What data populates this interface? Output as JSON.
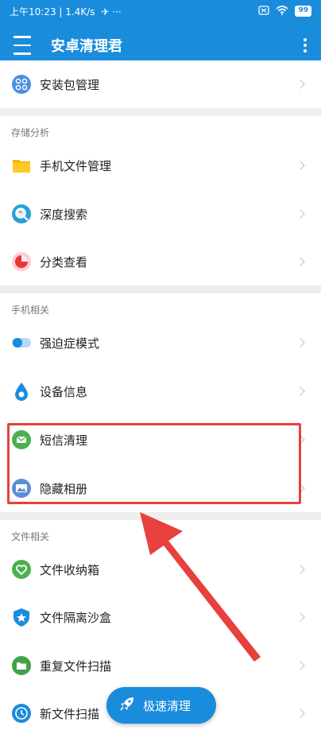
{
  "status_bar": {
    "time": "上午10:23",
    "speed": "1.4K/s",
    "battery": "99"
  },
  "app_bar": {
    "title": "安卓清理君",
    "menu_icon": "hamburger-menu-icon",
    "more_icon": "more-vertical-icon"
  },
  "rows": {
    "apk": {
      "label": "安装包管理",
      "icon": "apps-grid-icon",
      "color": "#4a90e2"
    },
    "file_manager": {
      "label": "手机文件管理",
      "icon": "folder-icon",
      "color": "#f5b800"
    },
    "deep_search": {
      "label": "深度搜索",
      "icon": "search-globe-icon",
      "color": "#2a9fd6"
    },
    "category": {
      "label": "分类查看",
      "icon": "pie-chart-icon",
      "color": "#e53935"
    },
    "ocd_mode": {
      "label": "强迫症模式",
      "icon": "toggle-icon",
      "color": "#1a8cdc"
    },
    "device_info": {
      "label": "设备信息",
      "icon": "drop-icon",
      "color": "#1a8cdc"
    },
    "sms_clean": {
      "label": "短信清理",
      "icon": "mail-icon",
      "color": "#4caf50"
    },
    "hidden_album": {
      "label": "隐藏相册",
      "icon": "photo-icon",
      "color": "#5b8fd6"
    },
    "file_box": {
      "label": "文件收纳箱",
      "icon": "heart-icon",
      "color": "#4caf50"
    },
    "sandbox": {
      "label": "文件隔离沙盒",
      "icon": "shield-icon",
      "color": "#1a8cdc"
    },
    "dup_scan": {
      "label": "重复文件扫描",
      "icon": "folder-green-icon",
      "color": "#43a047"
    },
    "new_file_scan": {
      "label": "新文件扫描",
      "icon": "clock-icon",
      "color": "#1a8cdc"
    }
  },
  "sections": {
    "storage": "存储分析",
    "phone": "手机相关",
    "files": "文件相关"
  },
  "fab": {
    "label": "极速清理",
    "icon": "rocket-icon"
  },
  "colors": {
    "primary": "#1a8cdc",
    "highlight": "#e8403c"
  }
}
